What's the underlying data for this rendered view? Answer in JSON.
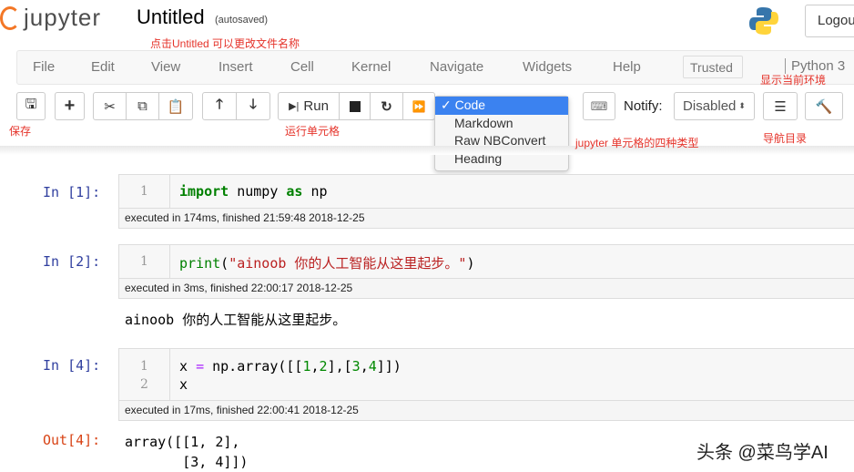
{
  "header": {
    "logo_text": "jupyter",
    "title": "Untitled",
    "autosave_status": "(autosaved)",
    "logout_label": "Logout"
  },
  "menubar": {
    "items": [
      "File",
      "Edit",
      "View",
      "Insert",
      "Cell",
      "Kernel",
      "Navigate",
      "Widgets",
      "Help"
    ],
    "trusted_label": "Trusted",
    "kernel_name": "Python 3"
  },
  "toolbar": {
    "run_label": "Run",
    "cell_type_options": [
      "Code",
      "Markdown",
      "Raw NBConvert",
      "Heading"
    ],
    "cell_type_selected": "Code",
    "notify_label": "Notify:",
    "notify_value": "Disabled"
  },
  "annotations": {
    "rename": "点击Untitled 可以更改文件名称",
    "save": "保存",
    "run": "运行单元格",
    "cell_types": "jupyter 单元格的四种类型",
    "kernel_env": "显示当前环境",
    "toc": "导航目录"
  },
  "cells": [
    {
      "prompt": "In [1]:",
      "lines": [
        "1"
      ],
      "exec": "executed in 174ms, finished 21:59:48 2018-12-25"
    },
    {
      "prompt": "In [2]:",
      "lines": [
        "1"
      ],
      "exec": "executed in 3ms, finished 22:00:17 2018-12-25",
      "stdout": "ainoob 你的人工智能从这里起步。"
    },
    {
      "prompt": "In [4]:",
      "lines": [
        "1",
        "2"
      ],
      "exec": "executed in 17ms, finished 22:00:41 2018-12-25",
      "out_prompt": "Out[4]:",
      "output": [
        "array([[1, 2],",
        "       [3, 4]])"
      ]
    }
  ],
  "code": {
    "c1": {
      "kw": "import",
      "a": " numpy ",
      "kw2": "as",
      "b": " np"
    },
    "c2": {
      "fn": "print",
      "p1": "(",
      "s": "\"ainoob 你的人工智能从这里起步。\"",
      "p2": ")"
    },
    "c4": {
      "a": "x ",
      "op": "=",
      "b": " np.array([[",
      "n1": "1",
      "c": ",",
      "n2": "2",
      "d": "],[",
      "n3": "3",
      "e": ",",
      "n4": "4",
      "f": "]])",
      "line2": "x"
    }
  },
  "watermark": "头条 @菜鸟学AI",
  "colors": {
    "annotation": "#e5332a",
    "prompt_in": "#303f9f",
    "prompt_out": "#d84315",
    "selected": "#3b82f0"
  }
}
